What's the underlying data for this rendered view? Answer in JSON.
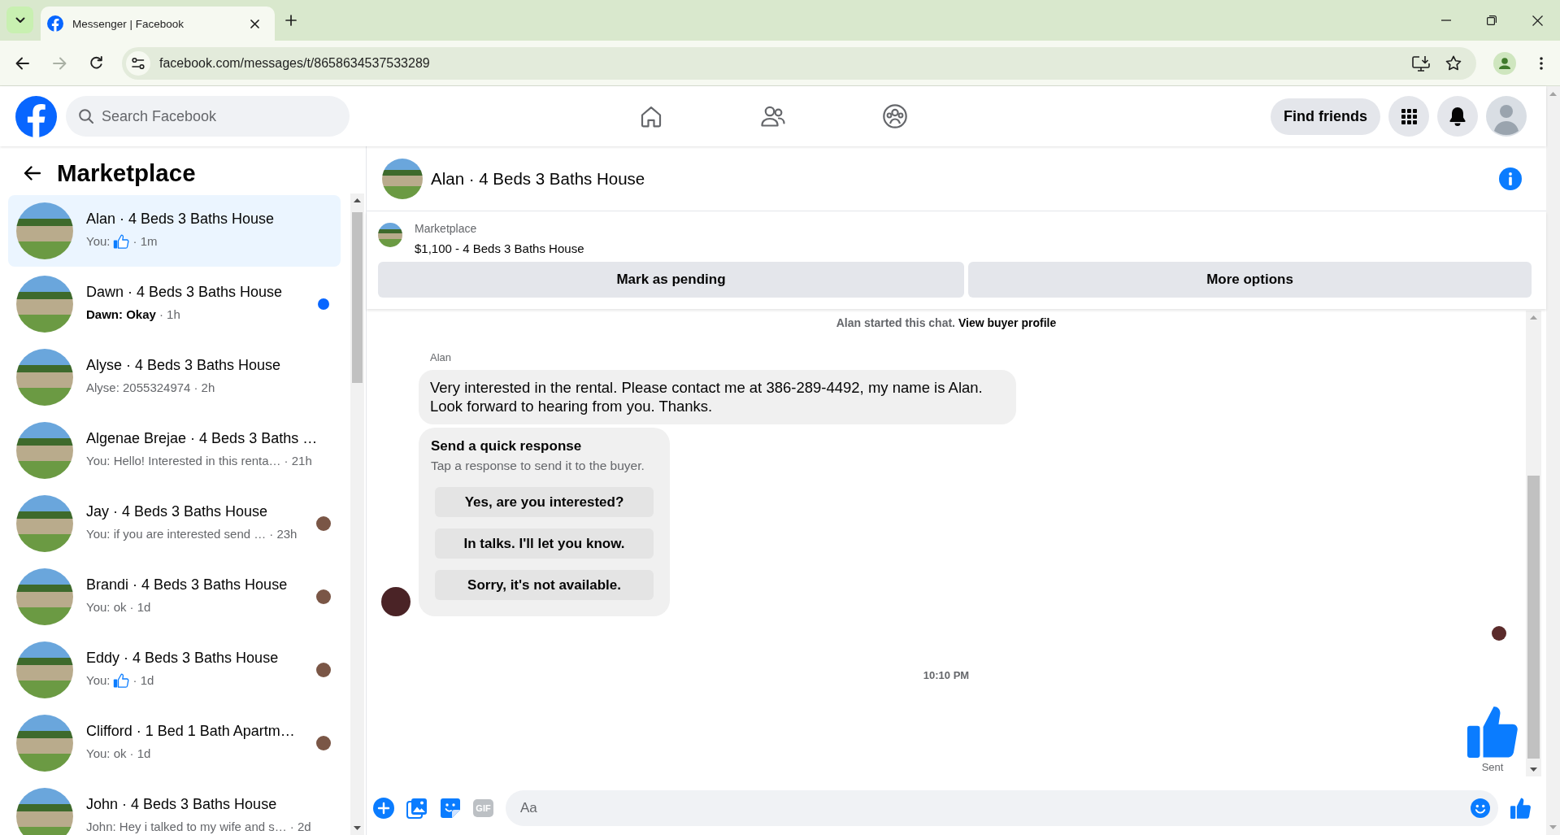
{
  "browser": {
    "tab_title": "Messenger | Facebook",
    "url": "facebook.com/messages/t/8658634537533289",
    "forward_disabled": true
  },
  "topbar": {
    "search": {
      "placeholder": "Search Facebook"
    },
    "find_friends": "Find friends"
  },
  "sidebar": {
    "title": "Marketplace",
    "conversations": [
      {
        "name": "Alan · 4 Beds 3 Baths House",
        "preview": "You:",
        "like": true,
        "time": "· 1m",
        "selected": true,
        "unread": false,
        "seen": false
      },
      {
        "name": "Dawn · 4 Beds 3 Baths House",
        "preview": "Dawn: Okay",
        "like": false,
        "time": "· 1h",
        "selected": false,
        "unread": true,
        "seen": false
      },
      {
        "name": "Alyse · 4 Beds 3 Baths House",
        "preview": "Alyse: 2055324974",
        "like": false,
        "time": "· 2h",
        "selected": false,
        "unread": false,
        "seen": false
      },
      {
        "name": "Algenae Brejae · 4 Beds 3 Baths …",
        "preview": "You: Hello! Interested in this renta…",
        "like": false,
        "time": "· 21h",
        "selected": false,
        "unread": false,
        "seen": false
      },
      {
        "name": "Jay · 4 Beds 3 Baths House",
        "preview": "You: if you are interested send …",
        "like": false,
        "time": "· 23h",
        "selected": false,
        "unread": false,
        "seen": true
      },
      {
        "name": "Brandi · 4 Beds 3 Baths House",
        "preview": "You: ok",
        "like": false,
        "time": "· 1d",
        "selected": false,
        "unread": false,
        "seen": true
      },
      {
        "name": "Eddy · 4 Beds 3 Baths House",
        "preview": "You:",
        "like": true,
        "time": "· 1d",
        "selected": false,
        "unread": false,
        "seen": true
      },
      {
        "name": "Clifford · 1 Bed 1 Bath Apartm…",
        "preview": "You: ok",
        "like": false,
        "time": "· 1d",
        "selected": false,
        "unread": false,
        "seen": true
      },
      {
        "name": "John · 4 Beds 3 Baths House",
        "preview": "John: Hey i talked to my wife and s…",
        "like": false,
        "time": "· 2d",
        "selected": false,
        "unread": false,
        "seen": false
      }
    ]
  },
  "chat": {
    "title": "Alan · 4 Beds 3 Baths House",
    "listing": {
      "label": "Marketplace",
      "title": "$1,100 - 4 Beds 3 Baths House"
    },
    "actions": [
      "Mark as pending",
      "More options"
    ],
    "thread": [
      {
        "kind": "notice",
        "text": "Alan started this chat.",
        "link": "View buyer profile"
      },
      {
        "kind": "incoming_group",
        "sender": "Alan",
        "messages": [
          {
            "kind": "text",
            "text": "Very interested in the rental. Please contact me at 386-289-4492, my name is Alan. Look forward to hearing from you. Thanks."
          },
          {
            "kind": "quick_replies",
            "title": "Send a quick response",
            "subtitle": "Tap a response to send it to the buyer.",
            "options": [
              "Yes, are you interested?",
              "In talks. I'll let you know.",
              "Sorry, it's not available."
            ]
          }
        ]
      },
      {
        "kind": "seen"
      },
      {
        "kind": "timestamp",
        "text": "10:10 PM"
      },
      {
        "kind": "like",
        "status": "Sent"
      }
    ],
    "composer": {
      "placeholder": "Aa",
      "gif_label": "GIF"
    }
  }
}
